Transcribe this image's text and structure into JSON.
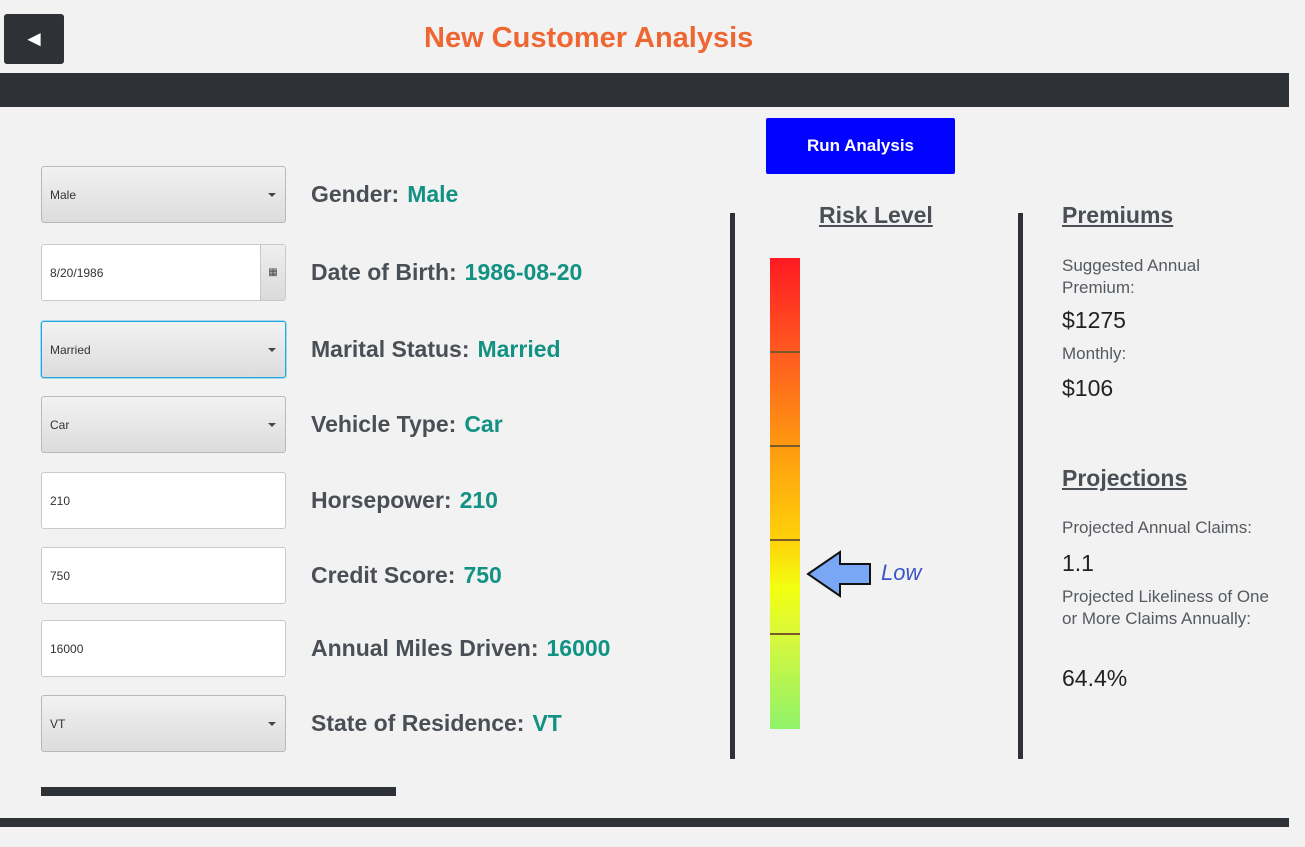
{
  "header": {
    "back_icon": "◄",
    "title": "New Customer Analysis"
  },
  "form": {
    "gender": {
      "input": "Male",
      "label": "Gender:",
      "value": "Male"
    },
    "dob": {
      "input": "8/20/1986",
      "calendar_icon": "▦",
      "label": "Date of Birth:",
      "value": "1986-08-20"
    },
    "marital": {
      "input": "Married",
      "label": "Marital Status:",
      "value": "Married"
    },
    "vehicle": {
      "input": "Car",
      "label": "Vehicle Type:",
      "value": "Car"
    },
    "horsepower": {
      "input": "210",
      "label": "Horsepower:",
      "value": "210"
    },
    "credit": {
      "input": "750",
      "label": "Credit Score:",
      "value": "750"
    },
    "miles": {
      "input": "16000",
      "label": "Annual Miles Driven:",
      "value": "16000"
    },
    "state": {
      "input": "VT",
      "label": "State of Residence:",
      "value": "VT"
    }
  },
  "actions": {
    "run_label": "Run Analysis"
  },
  "risk": {
    "title": "Risk Level",
    "level_text": "Low",
    "level_fraction": 0.33,
    "colors": {
      "high": "#ff1a22",
      "low": "#8ff26a",
      "arrow": "#7aa7f5"
    }
  },
  "premiums": {
    "title": "Premiums",
    "annual_label": "Suggested Annual Premium:",
    "annual_value": "$1275",
    "monthly_label": "Monthly:",
    "monthly_value": "$106"
  },
  "projections": {
    "title": "Projections",
    "claims_label": "Projected Annual Claims:",
    "claims_value": "1.1",
    "likeliness_label": "Projected Likeliness of One or More Claims Annually:",
    "likeliness_value": "64.4%"
  },
  "colors": {
    "accent_title": "#ee6733",
    "value_green": "#129283",
    "run_button": "#0202ff",
    "bar_dark": "#2e3236"
  }
}
